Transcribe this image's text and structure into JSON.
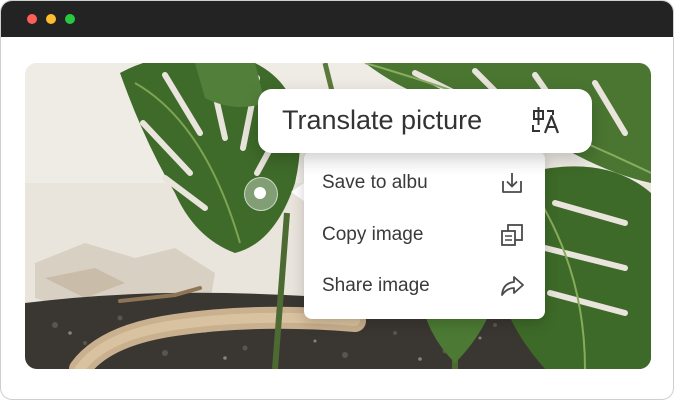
{
  "window": {
    "controls": [
      "close",
      "minimize",
      "maximize"
    ]
  },
  "translate": {
    "label": "Translate picture",
    "icon": "translate-icon"
  },
  "context_menu": {
    "items": [
      {
        "label": "Save to albu",
        "icon": "download-icon"
      },
      {
        "label": "Copy image",
        "icon": "copy-icon"
      },
      {
        "label": "Share image",
        "icon": "share-icon"
      }
    ]
  },
  "colors": {
    "titlebar": "#232323",
    "close": "#ff5f57",
    "minimize": "#febc2e",
    "maximize": "#28c840",
    "menu_text": "#3a3a3a",
    "icon_stroke": "#4a4a4a"
  }
}
